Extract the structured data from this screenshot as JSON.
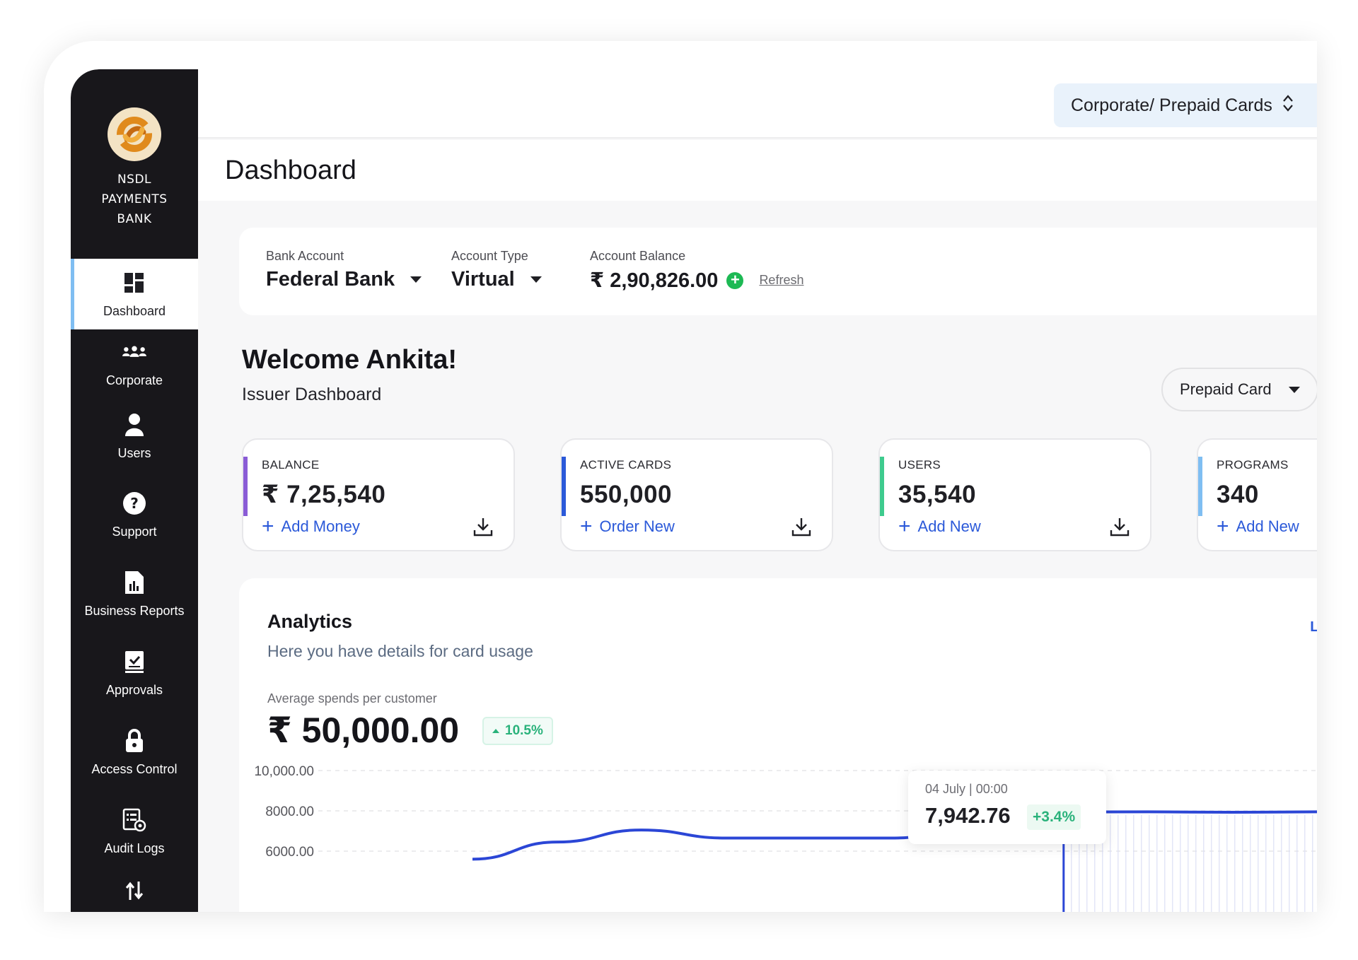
{
  "brand": {
    "name_line1": "NSDL",
    "name_line2": "PAYMENTS",
    "name_line3": "BANK"
  },
  "sidebar": {
    "items": [
      {
        "label": "Dashboard",
        "icon": "dashboard-icon",
        "active": true
      },
      {
        "label": "Corporate",
        "icon": "group-icon"
      },
      {
        "label": "Users",
        "icon": "user-icon"
      },
      {
        "label": "Support",
        "icon": "help-icon"
      },
      {
        "label": "Business Reports",
        "icon": "report-icon"
      },
      {
        "label": "Approvals",
        "icon": "approval-icon"
      },
      {
        "label": "Access Control",
        "icon": "lock-icon"
      },
      {
        "label": "Audit Logs",
        "icon": "audit-log-icon"
      }
    ]
  },
  "header": {
    "context_label": "Corporate/ Prepaid Cards",
    "page_title": "Dashboard"
  },
  "account": {
    "bank_label": "Bank Account",
    "bank_value": "Federal Bank",
    "type_label": "Account Type",
    "type_value": "Virtual",
    "balance_label": "Account Balance",
    "balance_value": "₹ 2,90,826.00",
    "refresh_label": "Refresh"
  },
  "welcome": {
    "title": "Welcome Ankita!",
    "subtitle": "Issuer Dashboard",
    "program_select": "Prepaid Card"
  },
  "stats": [
    {
      "label": "BALANCE",
      "value": "₹ 7,25,540",
      "action": "Add Money",
      "color": "#8a5cd6"
    },
    {
      "label": "ACTIVE CARDS",
      "value": "550,000",
      "action": "Order New",
      "color": "#2b59d9"
    },
    {
      "label": "USERS",
      "value": "35,540",
      "action": "Add New",
      "color": "#3ecb8e"
    },
    {
      "label": "PROGRAMS",
      "value": "340",
      "action": "Add New",
      "color": "#7fbef2"
    }
  ],
  "analytics": {
    "title": "Analytics",
    "subtitle": "Here you have details for card usage",
    "link_partial": "Li",
    "avg_label": "Average spends per customer",
    "avg_value": "₹ 50,000.00",
    "trend_value": "10.5%",
    "tooltip": {
      "date": "04 July | 00:00",
      "value": "7,942.76",
      "change": "+3.4%"
    }
  },
  "chart_data": {
    "type": "line",
    "y_ticks": [
      "10,000.00",
      "8000.00",
      "6000.00"
    ],
    "ylim": [
      6000,
      10000
    ],
    "grid": true,
    "series": [
      {
        "x": [
          0,
          1,
          2,
          3,
          4,
          5,
          6,
          7,
          8,
          9,
          10
        ],
        "values": [
          5600,
          6450,
          7050,
          6650,
          6650,
          6650,
          7300,
          7942.76,
          7950,
          7930,
          7950
        ]
      }
    ],
    "line_color": "#2b46d6"
  }
}
